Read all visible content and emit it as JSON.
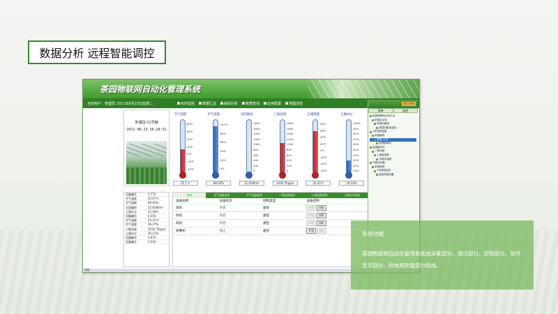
{
  "page": {
    "title": "数据分析 远程智能调控"
  },
  "app": {
    "title": "茶园物联网自动化管理系统",
    "status": "当前用户：管理员  2011年8月23日星期二",
    "menu": [
      "实时监控",
      "数据汇总",
      "曲线分析",
      "数据查询",
      "应用配置",
      "地图浏览"
    ],
    "exit": "退出系统",
    "statusbar": "完成"
  },
  "sidebar": {
    "tabs": [
      "菜单",
      "监控"
    ],
    "tree": [
      "茶园物联网示范平台",
      "茶园自动化",
      "茶园设备组",
      "茶园设备信息组",
      "1号茶园温度",
      "茶园植株",
      "茶园-01号",
      "茶园摄像机",
      "温湿度探头",
      "二氧化碳",
      "土壤温湿度",
      "光照传感器",
      "气象站设备",
      "茶园视频",
      "1号茶园监控",
      "智能茶园设置"
    ]
  },
  "station": {
    "name": "茶博园-01号棚",
    "time": "2011-08-23 16:28:52"
  },
  "gauges": [
    {
      "title": "空气温度",
      "ticks": [
        "80℃",
        "60℃",
        "40℃",
        "20℃",
        "0℃",
        "-20℃",
        "-40℃"
      ],
      "level": 0.45,
      "red": true,
      "readout": "25.1℃"
    },
    {
      "title": "空气湿度",
      "ticks": [
        "100%",
        "80%",
        "60%",
        "40%",
        "20%",
        "0%"
      ],
      "level": 0.88,
      "red": false,
      "readout": "88.65%"
    },
    {
      "title": "太阳辐射",
      "ticks": [
        "1800",
        "1600",
        "1400",
        "1200",
        "1000",
        "800",
        "600",
        "400",
        "200",
        "0"
      ],
      "level": 0.01,
      "red": false,
      "readout": "12.81W/m²"
    },
    {
      "title": "二氧化碳",
      "ticks": [
        "1800",
        "1600",
        "1400",
        "1200",
        "1000",
        "800",
        "600",
        "400",
        "200",
        "0"
      ],
      "level": 0.57,
      "red": true,
      "readout": "1030.76ppm"
    },
    {
      "title": "土壤温度",
      "ticks": [
        "40℃",
        "30℃",
        "20℃",
        "10℃",
        "0℃",
        "-10℃",
        "-20℃",
        "-30℃"
      ],
      "level": 0.79,
      "red": true,
      "readout": "25.42℃"
    },
    {
      "title": "土壤水分",
      "ticks": [
        "100%",
        "90%",
        "80%",
        "70%",
        "60%",
        "50%",
        "40%",
        "30%",
        "20%",
        "10%"
      ],
      "level": 0.24,
      "red": false,
      "readout": "24.34%"
    }
  ],
  "readings": [
    [
      "设备编号",
      "3.77V"
    ],
    [
      "空气温度",
      "25.07℃"
    ],
    [
      "空气湿度",
      "89.62%"
    ],
    [
      "太阳辐射",
      "12.81W/m²"
    ],
    [
      "土壤水分",
      "22.56%"
    ],
    [
      "设备编号",
      "4.35V"
    ],
    [
      "空气温度",
      "25.12℃"
    ],
    [
      "空气湿度",
      "69.27%"
    ],
    [
      "二氧化碳",
      "1030.76ppm"
    ],
    [
      "土壤水分",
      "26.11%"
    ],
    [
      "设备编号",
      "3.87V"
    ],
    [
      "设备编号",
      "3.93V"
    ]
  ],
  "device": {
    "tabs": [
      "控制",
      "空气温度曲线",
      "空气湿度曲线",
      "二氧化碳曲线",
      "土壤温度曲线",
      "土壤水分曲线"
    ],
    "headers": [
      "设备名称",
      "设备状态",
      "控制类型",
      "设备控制"
    ],
    "rows": [
      {
        "name": "风机",
        "state": "开启",
        "type": "遥控"
      },
      {
        "name": "风机",
        "state": "开启",
        "type": "遥控"
      },
      {
        "name": "风机",
        "state": "开启",
        "type": "遥控"
      },
      {
        "name": "喷雾机",
        "state": "停止",
        "type": "遥控"
      }
    ],
    "btn_open": "开机",
    "btn_close": "关机"
  },
  "info": {
    "title": "系统功能",
    "text": "茶园物联网自动化管理系统由采集部分、通讯部分、控制部分、软件显示部分、供电和防雷部分组成。"
  }
}
